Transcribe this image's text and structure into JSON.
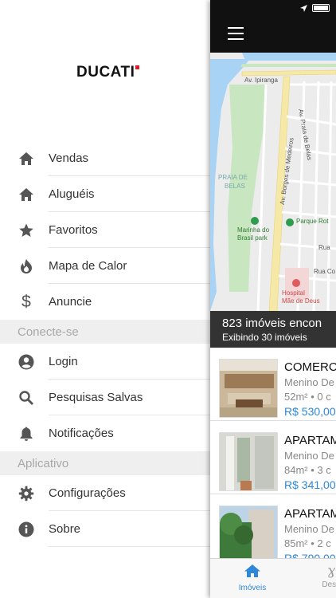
{
  "drawer": {
    "logo": "DUCATI",
    "items_top": [
      {
        "label": "Vendas",
        "icon": "home-icon"
      },
      {
        "label": "Aluguéis",
        "icon": "home-icon"
      },
      {
        "label": "Favoritos",
        "icon": "star-icon"
      },
      {
        "label": "Mapa de Calor",
        "icon": "flame-icon"
      },
      {
        "label": "Anuncie",
        "icon": "dollar-icon"
      }
    ],
    "section_connect": "Conecte-se",
    "items_connect": [
      {
        "label": "Login",
        "icon": "user-icon"
      },
      {
        "label": "Pesquisas Salvas",
        "icon": "search-icon"
      },
      {
        "label": "Notificações",
        "icon": "bell-icon"
      }
    ],
    "section_app": "Aplicativo",
    "items_app": [
      {
        "label": "Configurações",
        "icon": "gear-icon"
      },
      {
        "label": "Sobre",
        "icon": "info-icon"
      }
    ]
  },
  "main": {
    "map_labels": {
      "street_ipiranga": "Av. Ipiranga",
      "street_praia_belas": "Av. Praia de Belas",
      "street_borges": "Av. Borges de Medeiros",
      "area_praia": "PRAIA DE",
      "area_belas": "BELAS",
      "park_marinha_1": "Marinha do",
      "park_marinha_2": "Brasil park",
      "park_rot": "Parque Rot",
      "hospital_1": "Hospital",
      "hospital_2": "Mãe de Deus",
      "rua_1": "Rua",
      "rua_2": "Rua Co"
    },
    "results_count": "823 imóveis encon",
    "results_shown": "Exibindo 30 imóveis",
    "listings": [
      {
        "title": "COMERCI",
        "location": "Menino De",
        "area": "52m² • 0 c",
        "price": "R$ 530,00"
      },
      {
        "title": "APARTAM",
        "location": "Menino De",
        "area": "84m² • 3 c",
        "price": "R$ 341,00"
      },
      {
        "title": "APARTAM",
        "location": "Menino De",
        "area": "85m² • 2 c",
        "price": "R$ 790,00"
      }
    ],
    "tabs": [
      {
        "label": "Imóveis",
        "icon": "home-icon",
        "active": true
      },
      {
        "label": "Dese",
        "icon": "draw-icon",
        "active": false
      }
    ]
  },
  "colors": {
    "accent": "#2f87d8",
    "topbar": "#111111",
    "logo_mark": "#e01c24",
    "section_bg": "#efefef"
  }
}
